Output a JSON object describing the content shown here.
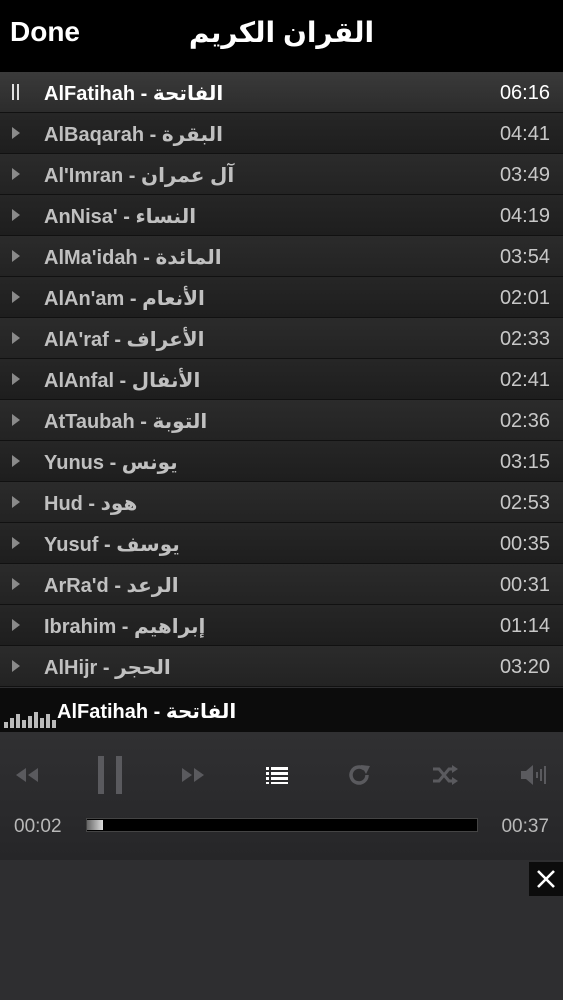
{
  "header": {
    "done_label": "Done",
    "title": "القران الكريم"
  },
  "playlist": [
    {
      "title": "AlFatihah - الفاتحة",
      "time": "06:16",
      "active": true
    },
    {
      "title": "AlBaqarah - البقرة",
      "time": "04:41"
    },
    {
      "title": "Al'Imran - آل عمران",
      "time": "03:49"
    },
    {
      "title": "AnNisa' - النساء",
      "time": "04:19"
    },
    {
      "title": "AlMa'idah - المائدة",
      "time": "03:54"
    },
    {
      "title": "AlAn'am - الأنعام",
      "time": "02:01"
    },
    {
      "title": "AlA'raf - الأعراف",
      "time": "02:33"
    },
    {
      "title": "AlAnfal - الأنفال",
      "time": "02:41"
    },
    {
      "title": "AtTaubah - التوبة",
      "time": "02:36"
    },
    {
      "title": "Yunus - يونس",
      "time": "03:15"
    },
    {
      "title": "Hud - هود",
      "time": "02:53"
    },
    {
      "title": "Yusuf - يوسف",
      "time": "00:35"
    },
    {
      "title": "ArRa'd - الرعد",
      "time": "00:31"
    },
    {
      "title": "Ibrahim - إبراهيم",
      "time": "01:14"
    },
    {
      "title": "AlHijr - الحجر",
      "time": "03:20"
    }
  ],
  "now_playing": {
    "title": "AlFatihah - الفاتحة"
  },
  "controls": {
    "icons": [
      "rewind-icon",
      "pause-icon",
      "fast-forward-icon",
      "playlist-icon",
      "repeat-icon",
      "shuffle-icon",
      "volume-icon"
    ]
  },
  "progress": {
    "elapsed": "00:02",
    "total": "00:37",
    "fraction": 0.04
  },
  "colors": {
    "header_bg": "#000000",
    "icon_dim": "#5a5a5e",
    "icon_active": "#ffffff"
  }
}
